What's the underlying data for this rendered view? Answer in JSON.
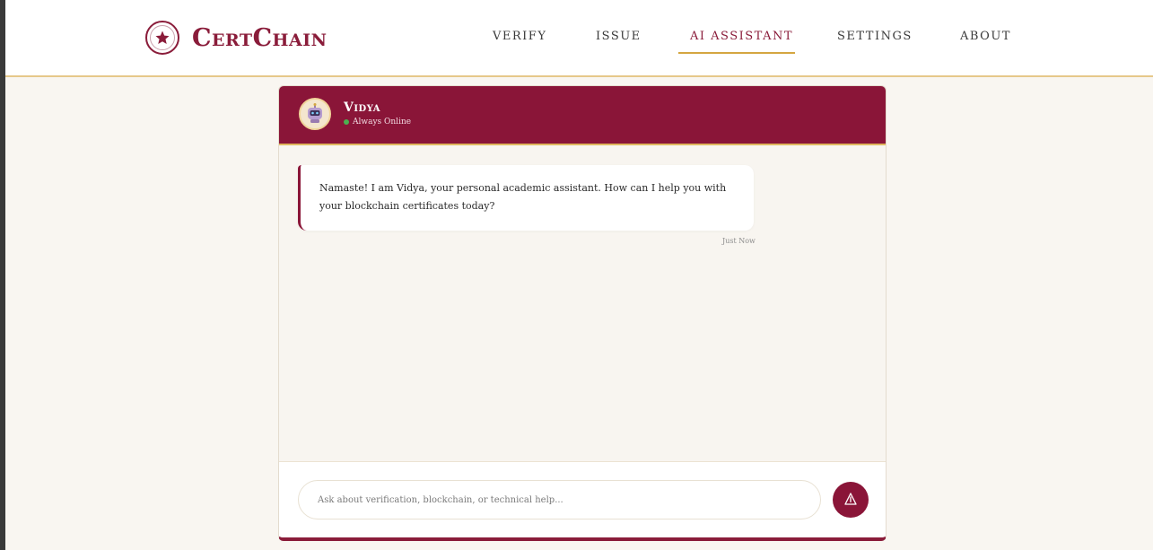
{
  "brand": {
    "name": "CertChain"
  },
  "nav": {
    "items": [
      {
        "label": "VERIFY"
      },
      {
        "label": "ISSUE"
      },
      {
        "label": "AI ASSISTANT"
      },
      {
        "label": "SETTINGS"
      },
      {
        "label": "ABOUT"
      }
    ],
    "active_index": 2
  },
  "chat": {
    "bot_name": "Vidya",
    "status": "Always Online",
    "messages": [
      {
        "text": "Namaste! I am Vidya, your personal academic assistant. How can I help you with your blockchain certificates today?",
        "time": "Just Now"
      }
    ],
    "input_placeholder": "Ask about verification, blockchain, or technical help...",
    "input_value": ""
  },
  "colors": {
    "accent": "#8a1538",
    "gold": "#d4a640",
    "online": "#4caf50",
    "background": "#f9f6f1"
  },
  "icons": {
    "logo": "star-seal-icon",
    "avatar": "robot-icon",
    "send": "send-arrow-icon"
  }
}
